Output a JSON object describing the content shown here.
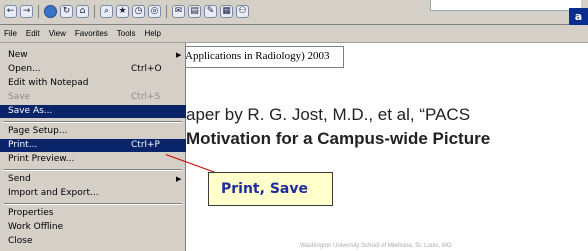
{
  "toolbar": {
    "icons": [
      "back-icon",
      "forward-icon",
      "stop-icon",
      "refresh-icon",
      "home-icon",
      "search-icon",
      "favorites-icon",
      "history-icon",
      "media-icon",
      "mail-icon",
      "print-icon",
      "edit-icon",
      "discuss-icon",
      "messenger-icon"
    ],
    "logo_text": "a"
  },
  "menubar": {
    "items": [
      "File",
      "Edit",
      "View",
      "Favorites",
      "Tools",
      "Help"
    ]
  },
  "file_menu": {
    "items": [
      {
        "label": "New",
        "shortcut": "",
        "submenu": true
      },
      {
        "label": "Open...",
        "shortcut": "Ctrl+O"
      },
      {
        "label": "Edit with Notepad",
        "shortcut": ""
      },
      {
        "label": "Save",
        "shortcut": "Ctrl+S",
        "disabled": true
      },
      {
        "label": "Save As...",
        "shortcut": "",
        "selected": true
      },
      {
        "label": "Page Setup...",
        "shortcut": ""
      },
      {
        "label": "Print...",
        "shortcut": "Ctrl+P",
        "selected": true
      },
      {
        "label": "Print Preview...",
        "shortcut": ""
      },
      {
        "label": "Send",
        "shortcut": "",
        "submenu": true
      },
      {
        "label": "Import and Export...",
        "shortcut": ""
      },
      {
        "label": "Properties",
        "shortcut": ""
      },
      {
        "label": "Work Offline",
        "shortcut": ""
      },
      {
        "label": "Close",
        "shortcut": ""
      }
    ]
  },
  "document": {
    "box_text": "Applications in Radiology) 2003",
    "line1": "aper by R. G. Jost, M.D., et al, “PACS",
    "line2": "Motivation for a Campus-wide Picture",
    "footer_text": "Washington University School of Medicine, St. Louis, MO"
  },
  "callout": {
    "text": "Print, Save"
  }
}
